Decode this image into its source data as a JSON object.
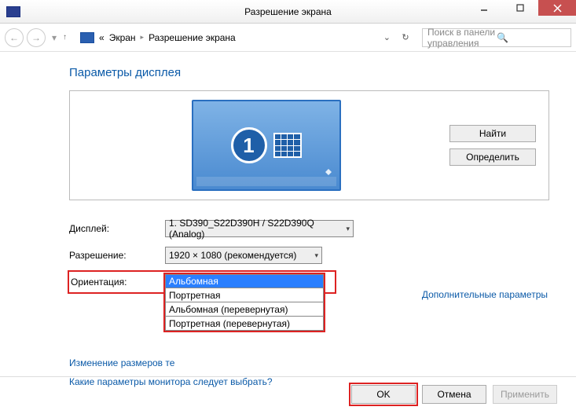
{
  "window": {
    "title": "Разрешение экрана"
  },
  "breadcrumb": {
    "root": "«",
    "item1": "Экран",
    "item2": "Разрешение экрана"
  },
  "search": {
    "placeholder": "Поиск в панели управления"
  },
  "heading": "Параметры дисплея",
  "monitor": {
    "number": "1"
  },
  "buttons": {
    "find": "Найти",
    "detect": "Определить",
    "ok": "OK",
    "cancel": "Отмена",
    "apply": "Применить"
  },
  "labels": {
    "display": "Дисплей:",
    "resolution": "Разрешение:",
    "orientation": "Ориентация:"
  },
  "values": {
    "display": "1. SD390_S22D390H / S22D390Q (Analog)",
    "resolution": "1920 × 1080 (рекомендуется)",
    "orientation": "Альбомная"
  },
  "orientation_options": [
    "Альбомная",
    "Портретная",
    "Альбомная (перевернутая)",
    "Портретная (перевернутая)"
  ],
  "links": {
    "advanced": "Дополнительные параметры",
    "resize_text": "Изменение размеров те",
    "which_monitor": "Какие параметры монитора следует выбрать?"
  }
}
